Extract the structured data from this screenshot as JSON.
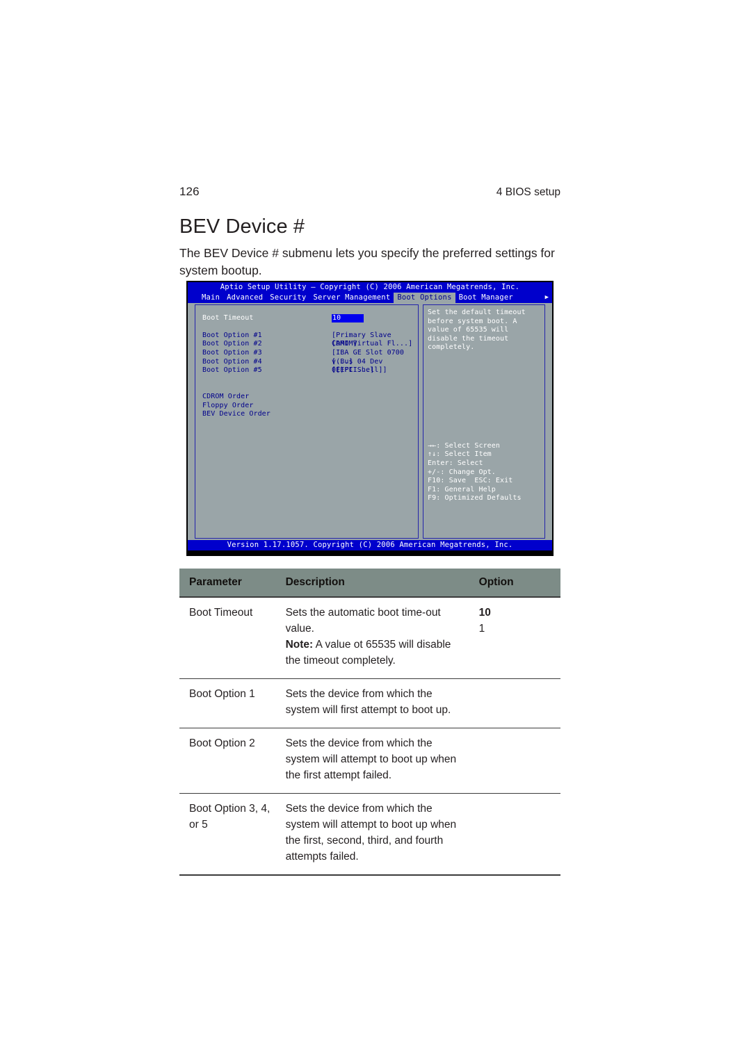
{
  "page": {
    "folio": "126",
    "running_head": "4 BIOS setup",
    "title": "BEV Device #",
    "intro": "The BEV Device # submenu lets you specify the preferred settings for system bootup."
  },
  "bios": {
    "titlebar": "Aptio Setup Utility – Copyright (C) 2006 American Megatrends, Inc.",
    "menu": [
      {
        "label": "Main",
        "active": false
      },
      {
        "label": "Advanced",
        "active": false
      },
      {
        "label": "Security",
        "active": false
      },
      {
        "label": "Server Management",
        "active": false
      },
      {
        "label": "Boot Options",
        "active": true
      },
      {
        "label": "Boot Manager",
        "active": false
      }
    ],
    "menu_more_arrow": "▶",
    "settings": [
      {
        "label": "Boot Timeout",
        "value": "10",
        "selected": true,
        "boxed": true
      },
      {
        "label": "Boot Option #1",
        "value": "[Primary Slave CDROM]",
        "selected": false,
        "boxed": false
      },
      {
        "label": "Boot Option #2",
        "value": "[AMI    Virtual Fl...]",
        "selected": false,
        "boxed": false
      },
      {
        "label": "Boot Option #3",
        "value": "[IBA GE Slot 0700 v...]",
        "selected": false,
        "boxed": false
      },
      {
        "label": "Boot Option #4",
        "value": "[(Bus 04 Dev 0E)PCI...]",
        "selected": false,
        "boxed": false
      },
      {
        "label": "Boot Option #5",
        "value": "[[EFI Shell]]",
        "selected": false,
        "boxed": false
      }
    ],
    "submenus": [
      "CDROM Order",
      "Floppy Order",
      "BEV Device Order"
    ],
    "help_text": "Set the default timeout before system boot.  A value of 65535 will disable the timeout completely.",
    "key_legend": [
      "→←: Select Screen",
      "↑↓: Select Item",
      "Enter: Select",
      "+/-: Change Opt.",
      "F10: Save  ESC: Exit",
      "F1: General Help",
      "F9: Optimized Defaults"
    ],
    "footer": "Version 1.17.1057. Copyright (C) 2006 American Megatrends, Inc.",
    "colors": {
      "chrome_blue": "#0000cc",
      "panel_gray": "#9aa5a8",
      "label_blue": "#00008b",
      "highlight_blue": "#0000ee",
      "border_blue": "#2222aa"
    }
  },
  "table": {
    "headers": {
      "parameter": "Parameter",
      "description": "Description",
      "option": "Option"
    },
    "rows": [
      {
        "parameter": "Boot Timeout",
        "desc_line1": "Sets the automatic boot time-out value.",
        "note_lead": "Note:",
        "note_rest": " A value ot 65535 will disable the timeout completely.",
        "option_bold": "10",
        "option_plain": "1"
      },
      {
        "parameter": "Boot Option 1",
        "desc_line1": "Sets the device from which the system will first attempt to boot up.",
        "option_bold": "",
        "option_plain": ""
      },
      {
        "parameter": "Boot Option 2",
        "desc_line1": "Sets the device from which the system will attempt to boot up when the first attempt failed.",
        "option_bold": "",
        "option_plain": ""
      },
      {
        "parameter": "Boot Option 3, 4, or 5",
        "desc_line1": "Sets the device from which the system will attempt to boot up when the first, second, third, and fourth attempts failed.",
        "option_bold": "",
        "option_plain": ""
      }
    ],
    "header_bg": "#7d8c87"
  }
}
